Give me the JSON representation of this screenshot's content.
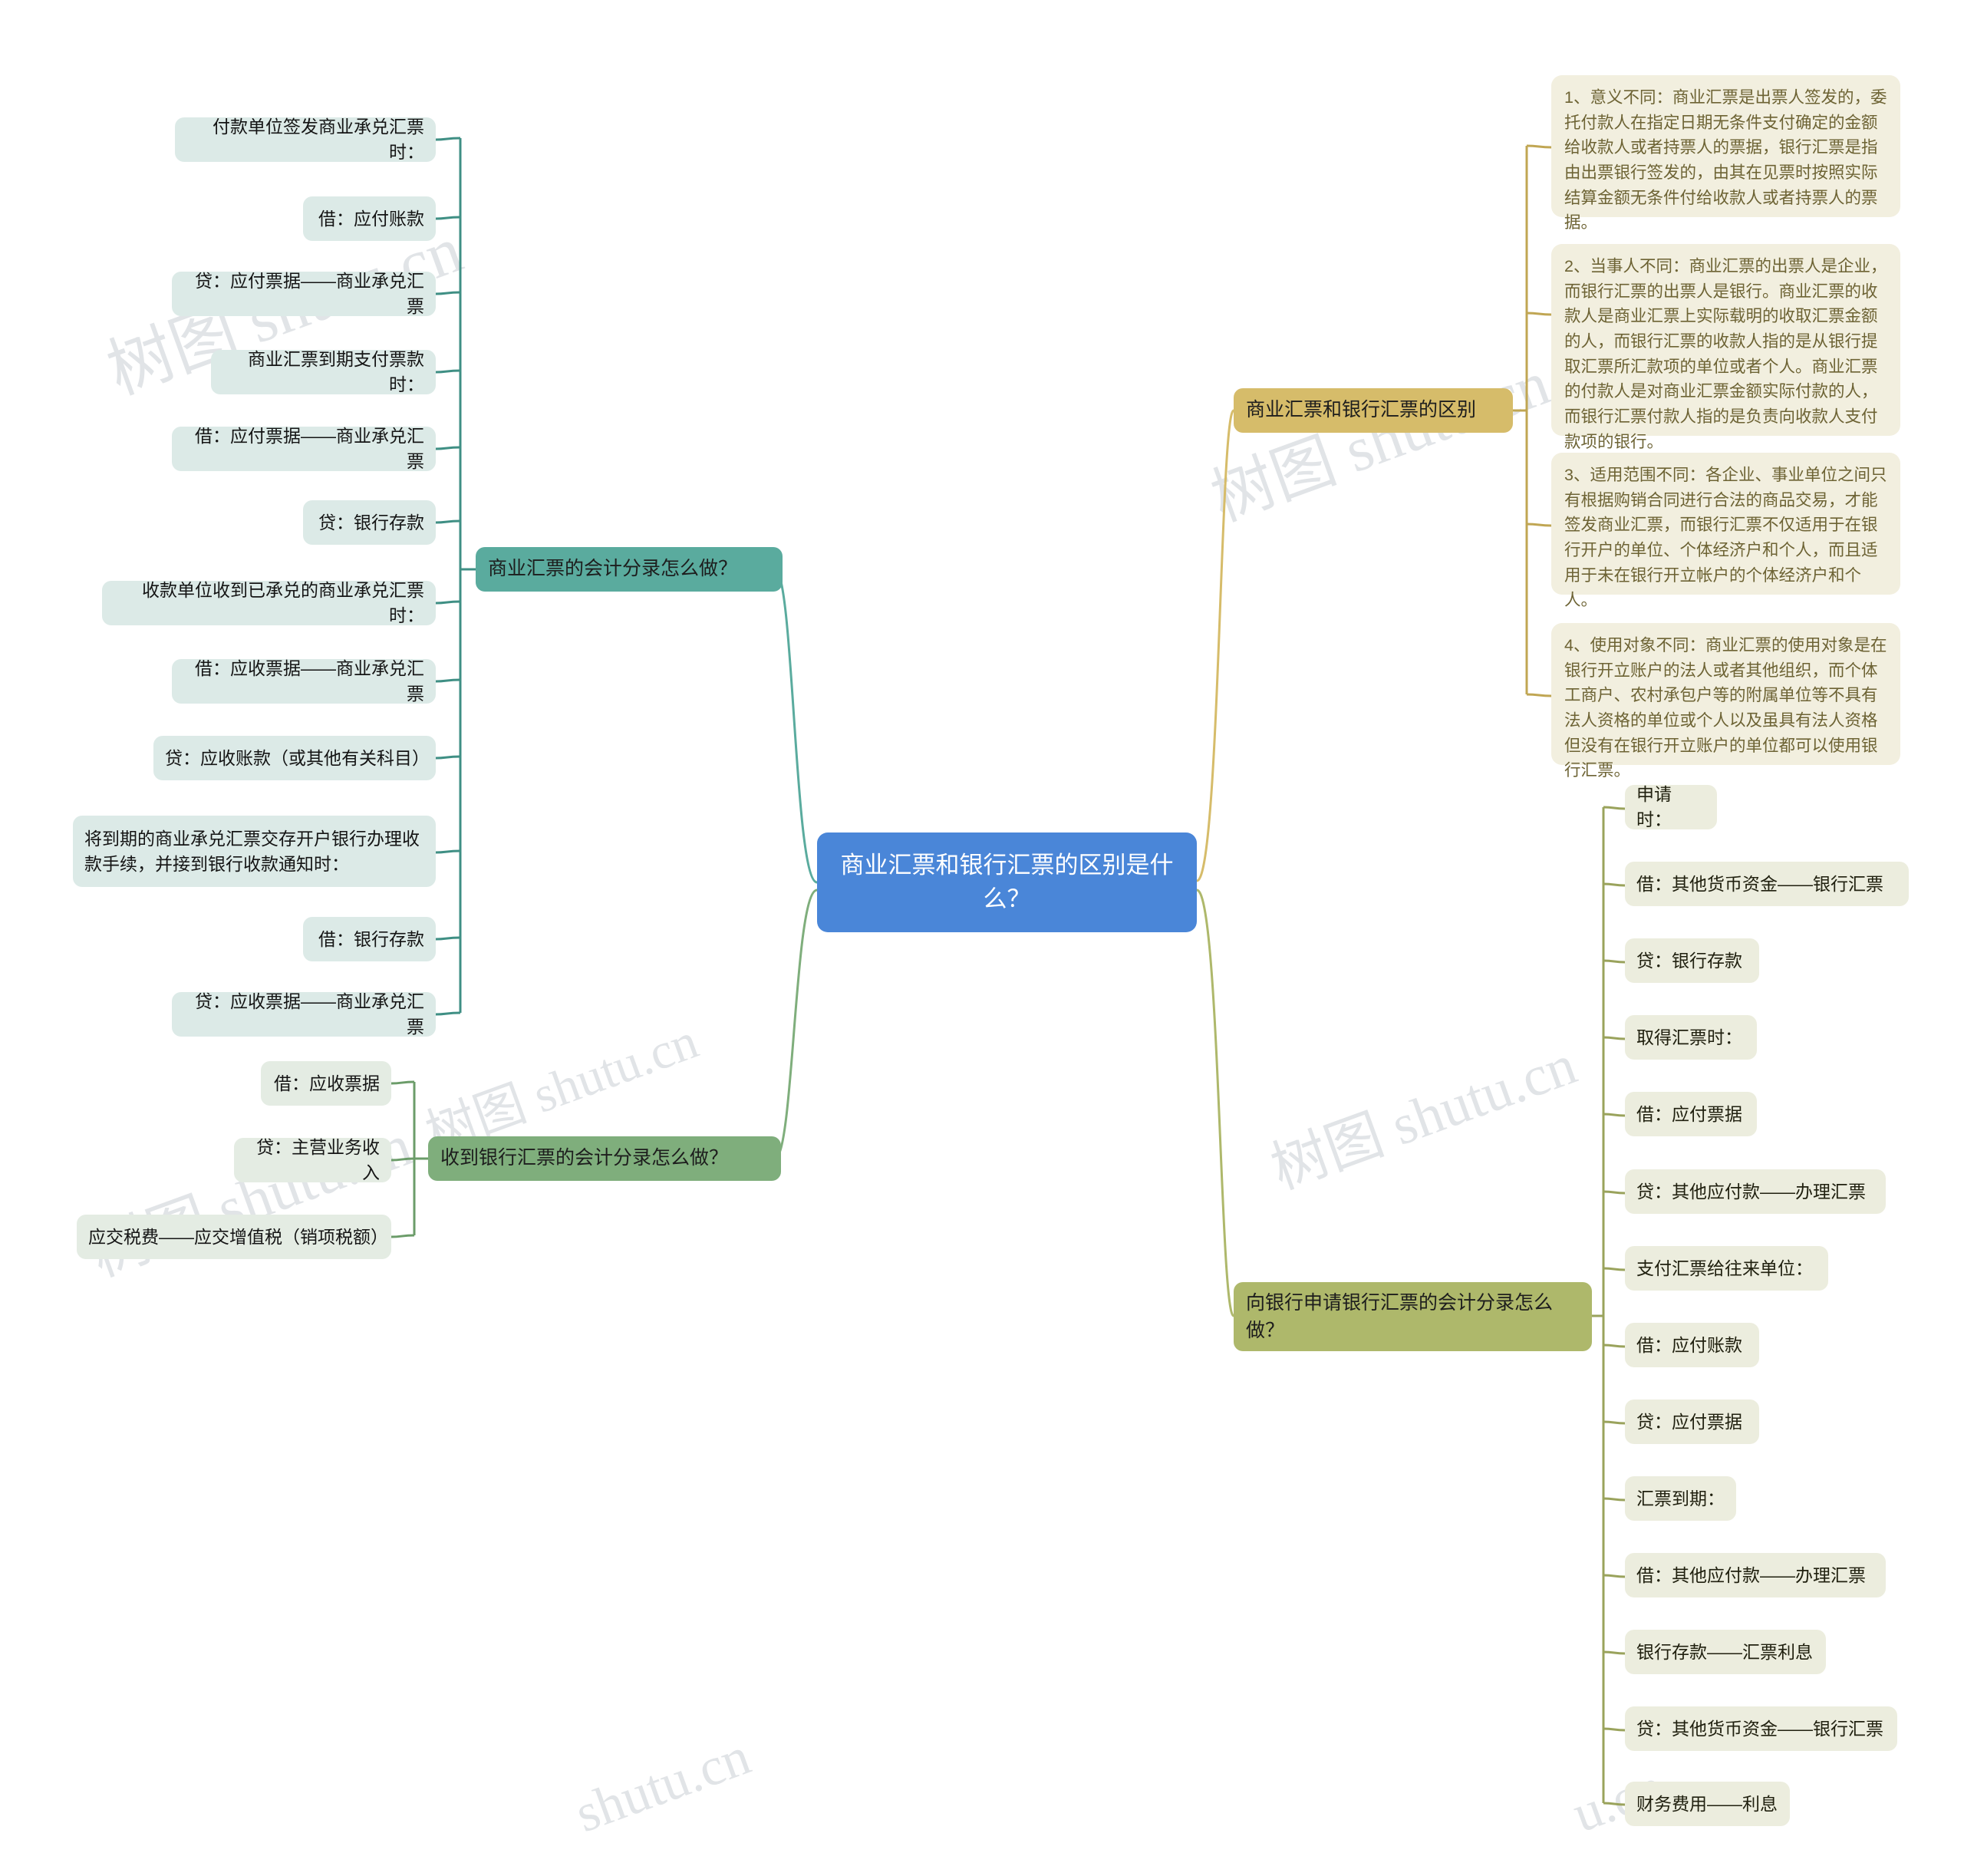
{
  "root": {
    "label": "商业汇票和银行汇票的区别是什么？",
    "color": "#4a86d8"
  },
  "watermarks": [
    "树图 shutu.cn",
    "树图 shutu.cn",
    "树图 shutu.cn",
    "树图 shutu.cn",
    "树图 shutu.cn",
    "shutu.cn",
    "u.cn"
  ],
  "branches": {
    "commercial_bill_entries": {
      "label": "商业汇票的会计分录怎么做？",
      "color": "#5aab9e",
      "leaf_color": "#dceae7",
      "items": [
        "付款单位签发商业承兑汇票时：",
        "借：应付账款",
        "贷：应付票据——商业承兑汇票",
        "商业汇票到期支付票款时：",
        "借：应付票据——商业承兑汇票",
        "贷：银行存款",
        "收款单位收到已承兑的商业承兑汇票时：",
        "借：应收票据——商业承兑汇票",
        "贷：应收账款（或其他有关科目）",
        "将到期的商业承兑汇票交存开户银行办理收款手续，并接到银行收款通知时：",
        "借：银行存款",
        "贷：应收票据——商业承兑汇票"
      ]
    },
    "received_bank_draft_entries": {
      "label": "收到银行汇票的会计分录怎么做？",
      "color": "#7fae7c",
      "leaf_color": "#e4ece3",
      "items": [
        "借：应收票据",
        "贷：主营业务收入",
        "应交税费——应交增值税（销项税额）"
      ]
    },
    "differences": {
      "label": "商业汇票和银行汇票的区别",
      "color": "#d6bc6a",
      "leaf_color": "#f2efdf",
      "items": [
        "1、意义不同：商业汇票是出票人签发的，委托付款人在指定日期无条件支付确定的金额给收款人或者持票人的票据，银行汇票是指由出票银行签发的，由其在见票时按照实际结算金额无条件付给收款人或者持票人的票据。",
        "2、当事人不同：商业汇票的出票人是企业，而银行汇票的出票人是银行。商业汇票的收款人是商业汇票上实际载明的收取汇票金额的人，而银行汇票的收款人指的是从银行提取汇票所汇款项的单位或者个人。商业汇票的付款人是对商业汇票金额实际付款的人，而银行汇票付款人指的是负责向收款人支付款项的银行。",
        "3、适用范围不同：各企业、事业单位之间只有根据购销合同进行合法的商品交易，才能签发商业汇票，而银行汇票不仅适用于在银行开户的单位、个体经济户和个人，而且适用于未在银行开立帐户的个体经济户和个人。",
        "4、使用对象不同：商业汇票的使用对象是在银行开立账户的法人或者其他组织，而个体工商户、农村承包户等的附属单位等不具有法人资格的单位或个人以及虽具有法人资格但没有在银行开立账户的单位都可以使用银行汇票。"
      ]
    },
    "apply_bank_draft_entries": {
      "label": "向银行申请银行汇票的会计分录怎么做？",
      "color": "#aeb86b",
      "leaf_color": "#ecedde",
      "items": [
        "申请时：",
        "借：其他货币资金——银行汇票",
        "贷：银行存款",
        "取得汇票时：",
        "借：应付票据",
        "贷：其他应付款——办理汇票",
        "支付汇票给往来单位：",
        "借：应付账款",
        "贷：应付票据",
        "汇票到期：",
        "借：其他应付款——办理汇票",
        "银行存款——汇票利息",
        "贷：其他货币资金——银行汇票",
        "财务费用——利息"
      ]
    }
  }
}
